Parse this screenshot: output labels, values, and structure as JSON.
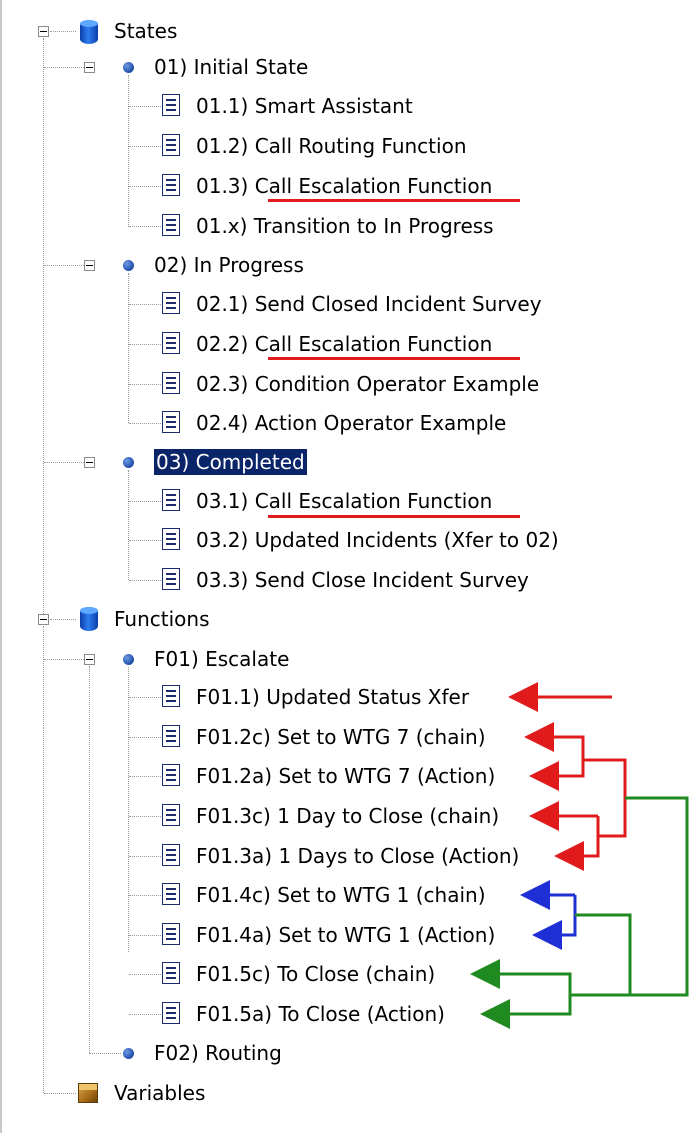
{
  "tree": {
    "groups": [
      {
        "label": "States",
        "icon": "database-icon",
        "children": [
          {
            "label": "01) Initial State",
            "icon": "state-dot-icon",
            "children": [
              {
                "label": "01.1) Smart Assistant"
              },
              {
                "label": "01.2) Call Routing Function"
              },
              {
                "label": "01.3) Call Escalation Function"
              },
              {
                "label": "01.x) Transition to In Progress"
              }
            ]
          },
          {
            "label": "02) In Progress",
            "icon": "state-dot-icon",
            "children": [
              {
                "label": "02.1) Send Closed Incident Survey"
              },
              {
                "label": "02.2) Call Escalation Function"
              },
              {
                "label": "02.3) Condition Operator Example"
              },
              {
                "label": "02.4) Action Operator Example"
              }
            ]
          },
          {
            "label": "03) Completed",
            "icon": "state-dot-icon",
            "selected": true,
            "children": [
              {
                "label": "03.1) Call Escalation Function"
              },
              {
                "label": "03.2) Updated Incidents (Xfer to 02)"
              },
              {
                "label": "03.3) Send Close Incident Survey"
              }
            ]
          }
        ]
      },
      {
        "label": "Functions",
        "icon": "database-icon",
        "children": [
          {
            "label": "F01) Escalate",
            "icon": "state-dot-icon",
            "children": [
              {
                "label": "F01.1) Updated Status Xfer"
              },
              {
                "label": "F01.2c) Set to WTG 7 (chain)"
              },
              {
                "label": "F01.2a) Set to WTG 7 (Action)"
              },
              {
                "label": "F01.3c) 1 Day to Close (chain)"
              },
              {
                "label": "F01.3a) 1 Days to Close (Action)"
              },
              {
                "label": "F01.4c) Set to WTG 1 (chain)"
              },
              {
                "label": "F01.4a) Set to WTG 1 (Action)"
              },
              {
                "label": "F01.5c) To Close (chain)"
              },
              {
                "label": "F01.5a) To Close (Action)"
              }
            ]
          },
          {
            "label": "F02) Routing",
            "icon": "state-dot-icon",
            "children": []
          }
        ]
      },
      {
        "label": "Variables",
        "icon": "package-icon",
        "children": []
      }
    ]
  },
  "annotation_colors": {
    "underline": "#e11b1b",
    "red_arrows": "#e11b1b",
    "blue_arrows": "#1f2fd6",
    "green_arrows": "#1f8a1f"
  }
}
